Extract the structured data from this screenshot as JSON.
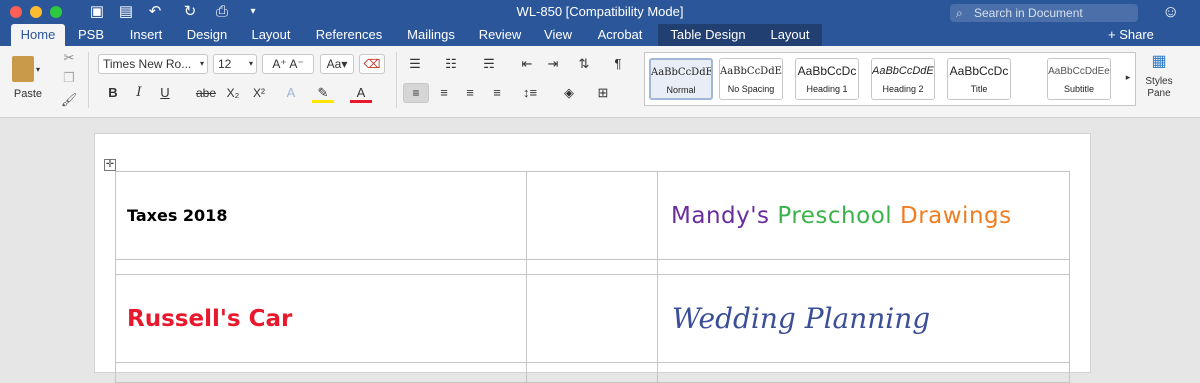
{
  "window": {
    "title": "WL-850 [Compatibility Mode]",
    "search_placeholder": "Search in Document",
    "icons": [
      "sidebar-toggle-icon",
      "save-icon",
      "undo-icon",
      "redo-icon",
      "print-icon",
      "customize-qa-icon",
      "user-smiley-icon"
    ]
  },
  "tabs": [
    {
      "label": "Home"
    },
    {
      "label": "PSB"
    },
    {
      "label": "Insert"
    },
    {
      "label": "Design"
    },
    {
      "label": "Layout"
    },
    {
      "label": "References"
    },
    {
      "label": "Mailings"
    },
    {
      "label": "Review"
    },
    {
      "label": "View"
    },
    {
      "label": "Acrobat"
    },
    {
      "label": "Table Design"
    },
    {
      "label": "Layout"
    }
  ],
  "share": "+ Share",
  "ribbon": {
    "paste": "Paste",
    "font_name": "Times New Ro...",
    "font_size": "12",
    "bold": "B",
    "italic": "I",
    "underline": "U",
    "strike": "abe",
    "subscript": "X₂",
    "superscript": "X²",
    "styles_pane": "Styles Pane",
    "styles": [
      {
        "preview": "AaBbCcDdEe",
        "name": "Normal"
      },
      {
        "preview": "AaBbCcDdEe",
        "name": "No Spacing"
      },
      {
        "preview": "AaBbCcDc",
        "name": "Heading 1"
      },
      {
        "preview": "AaBbCcDdEe",
        "name": "Heading 2"
      },
      {
        "preview": "AaBbCcDc",
        "name": "Title"
      },
      {
        "preview": "AaBbCcDdEe",
        "name": "Subtitle"
      }
    ]
  },
  "colors": {
    "accent": "#2b579a",
    "highlight": "#ffe600",
    "font_color": "#e8192c"
  },
  "document": {
    "taxes": "Taxes 2018",
    "mandys": "Mandy's",
    "preschool": "Preschool",
    "drawings": "Drawings",
    "russells": "Russell's Car",
    "wedding": "Wedding Planning"
  }
}
